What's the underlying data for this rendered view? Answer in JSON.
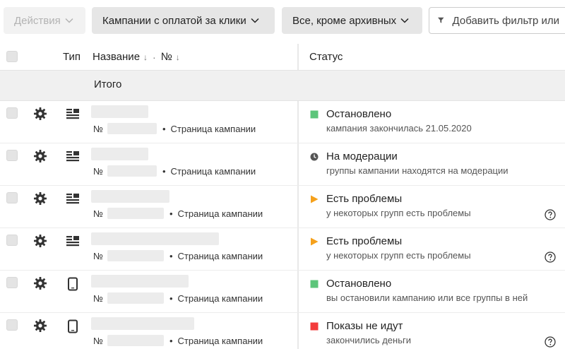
{
  "toolbar": {
    "actions_label": "Действия",
    "campaign_type_label": "Кампании с оплатой за клики",
    "archive_filter_label": "Все, кроме архивных",
    "add_filter_label": "Добавить фильтр или"
  },
  "table": {
    "col_type": "Тип",
    "col_name": "Название",
    "col_name_sort": "↓",
    "col_sep": "·",
    "col_number": "№",
    "col_number_sort": "↓",
    "col_status": "Статус",
    "total_label": "Итого"
  },
  "rows": [
    {
      "num_prefix": "№",
      "page_link": "Страница кампании",
      "type_icon": "text-ad-icon",
      "status_color": "#5cc57a",
      "status_icon": "square",
      "status_title": "Остановлено",
      "status_sub": "кампания закончилась 21.05.2020",
      "help": false
    },
    {
      "num_prefix": "№",
      "page_link": "Страница кампании",
      "type_icon": "text-ad-icon",
      "status_color": "#555555",
      "status_icon": "clock",
      "status_title": "На модерации",
      "status_sub": "группы кампании находятся на модерации",
      "help": false
    },
    {
      "num_prefix": "№",
      "page_link": "Страница кампании",
      "type_icon": "text-ad-icon",
      "status_color": "#f5a11c",
      "status_icon": "triangle",
      "status_title": "Есть проблемы",
      "status_sub": "у некоторых групп есть проблемы",
      "help": true
    },
    {
      "num_prefix": "№",
      "page_link": "Страница кампании",
      "type_icon": "text-ad-icon",
      "status_color": "#f5a11c",
      "status_icon": "triangle",
      "status_title": "Есть проблемы",
      "status_sub": "у некоторых групп есть проблемы",
      "help": true
    },
    {
      "num_prefix": "№",
      "page_link": "Страница кампании",
      "type_icon": "mobile-app-icon",
      "status_color": "#5cc57a",
      "status_icon": "square",
      "status_title": "Остановлено",
      "status_sub": "вы остановили кампанию или все группы в ней",
      "help": false
    },
    {
      "num_prefix": "№",
      "page_link": "Страница кампании",
      "type_icon": "mobile-app-icon",
      "status_color": "#f33b3b",
      "status_icon": "square",
      "status_title": "Показы не идут",
      "status_sub": "закончились деньги",
      "help": true
    }
  ]
}
